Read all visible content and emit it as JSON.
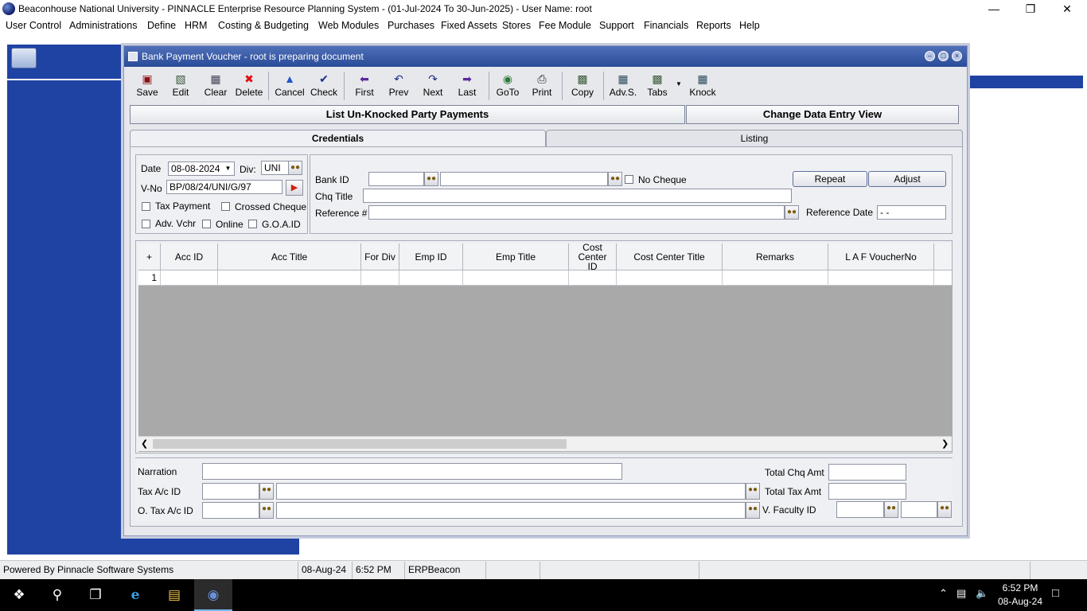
{
  "app": {
    "title": "Beaconhouse National University - PINNACLE Enterprise Resource Planning System  -  (01-Jul-2024 To 30-Jun-2025) - User Name: root"
  },
  "menu": [
    "User Control",
    "Administrations",
    "Define",
    "HRM",
    "Costing & Budgeting",
    "Web Modules",
    "Purchases",
    "Fixed Assets",
    "Stores",
    "Fee Module",
    "Support",
    "Financials",
    "Reports",
    "Help"
  ],
  "window": {
    "title": "Bank Payment Voucher - root is preparing document"
  },
  "toolbar": {
    "save": "Save",
    "edit": "Edit",
    "clear": "Clear",
    "delete": "Delete",
    "cancel": "Cancel",
    "check": "Check",
    "first": "First",
    "prev": "Prev",
    "next": "Next",
    "last": "Last",
    "goto": "GoTo",
    "print": "Print",
    "copy": "Copy",
    "advs": "Adv.S.",
    "tabs": "Tabs",
    "knock": "Knock"
  },
  "actions": {
    "list_unknocked": "List Un-Knocked Party Payments",
    "change_view": "Change Data Entry View"
  },
  "tabs": {
    "credentials": "Credentials",
    "listing": "Listing"
  },
  "form": {
    "date_label": "Date",
    "date_value": "08-08-2024",
    "div_label": "Div:",
    "div_value": "UNI",
    "vno_label": "V-No",
    "vno_value": "BP/08/24/UNI/G/97",
    "tax_payment": "Tax Payment",
    "crossed_cheque": "Crossed Cheque",
    "adv_vchr": "Adv. Vchr",
    "online": "Online",
    "goaid": "G.O.A.ID",
    "bank_id_label": "Bank ID",
    "no_cheque": "No Cheque",
    "chq_title_label": "Chq Title",
    "reference_label": "Reference #",
    "reference_date_label": "Reference Date",
    "reference_date_value": "- -",
    "repeat": "Repeat",
    "adjust": "Adjust"
  },
  "grid": {
    "columns": [
      "+",
      "Acc  ID",
      "Acc  Title",
      "For Div",
      "Emp  ID",
      "Emp  Title",
      "Cost Center ID",
      "Cost Center  Title",
      "Remarks",
      "L A F  VoucherNo"
    ],
    "row_number": "1"
  },
  "footer": {
    "narration": "Narration",
    "tax_ac_id": "Tax A/c ID",
    "o_tax_ac_id": "O. Tax A/c ID",
    "total_chq_amt": "Total Chq Amt",
    "total_tax_amt": "Total Tax Amt",
    "v_faculty_id": "V. Faculty ID"
  },
  "status": {
    "powered": "Powered By Pinnacle Software Systems",
    "date": "08-Aug-24",
    "time": "6:52 PM",
    "db": "ERPBeacon"
  },
  "taskbar": {
    "clock_time": "6:52 PM",
    "clock_date": "08-Aug-24"
  },
  "colors": {
    "mdi_blue": "#1f43a3",
    "title_blue": "#2a4b98"
  }
}
